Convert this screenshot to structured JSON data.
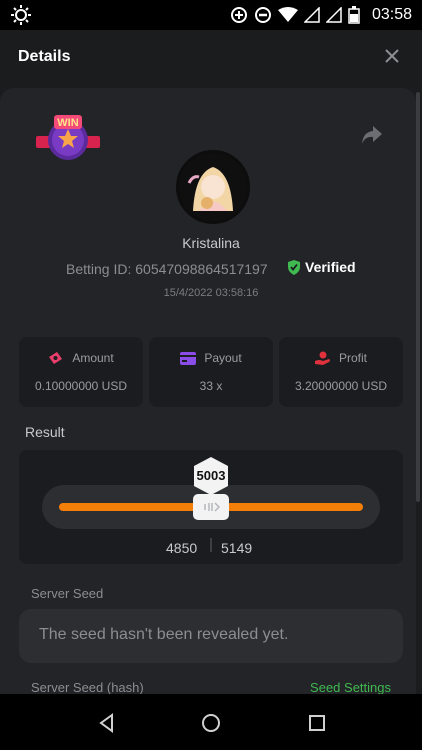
{
  "statusbar": {
    "time": "03:58"
  },
  "header": {
    "title": "Details"
  },
  "user": {
    "badge": "WIN",
    "name": "Kristalina",
    "betting_id": "Betting ID: 60547098864517197",
    "verified_label": "Verified",
    "datetime": "15/4/2022 03:58:16"
  },
  "stats": [
    {
      "label": "Amount",
      "value": "0.10000000 USD",
      "icon": "money-icon"
    },
    {
      "label": "Payout",
      "value": "33 x",
      "icon": "card-icon"
    },
    {
      "label": "Profit",
      "value": "3.20000000 USD",
      "icon": "hand-coin-icon"
    }
  ],
  "result": {
    "label": "Result",
    "value": "5003",
    "range_low": "4850",
    "range_high": "5149",
    "level": 0.5
  },
  "server_seed": {
    "label": "Server Seed",
    "placeholder": "The seed hasn't been revealed yet.",
    "hash_label": "Server Seed (hash)",
    "settings_link": "Seed Settings"
  },
  "colors": {
    "accent": "#f37f08",
    "verified": "#3fb950",
    "background": "#1b1c1e",
    "card": "#232427"
  }
}
